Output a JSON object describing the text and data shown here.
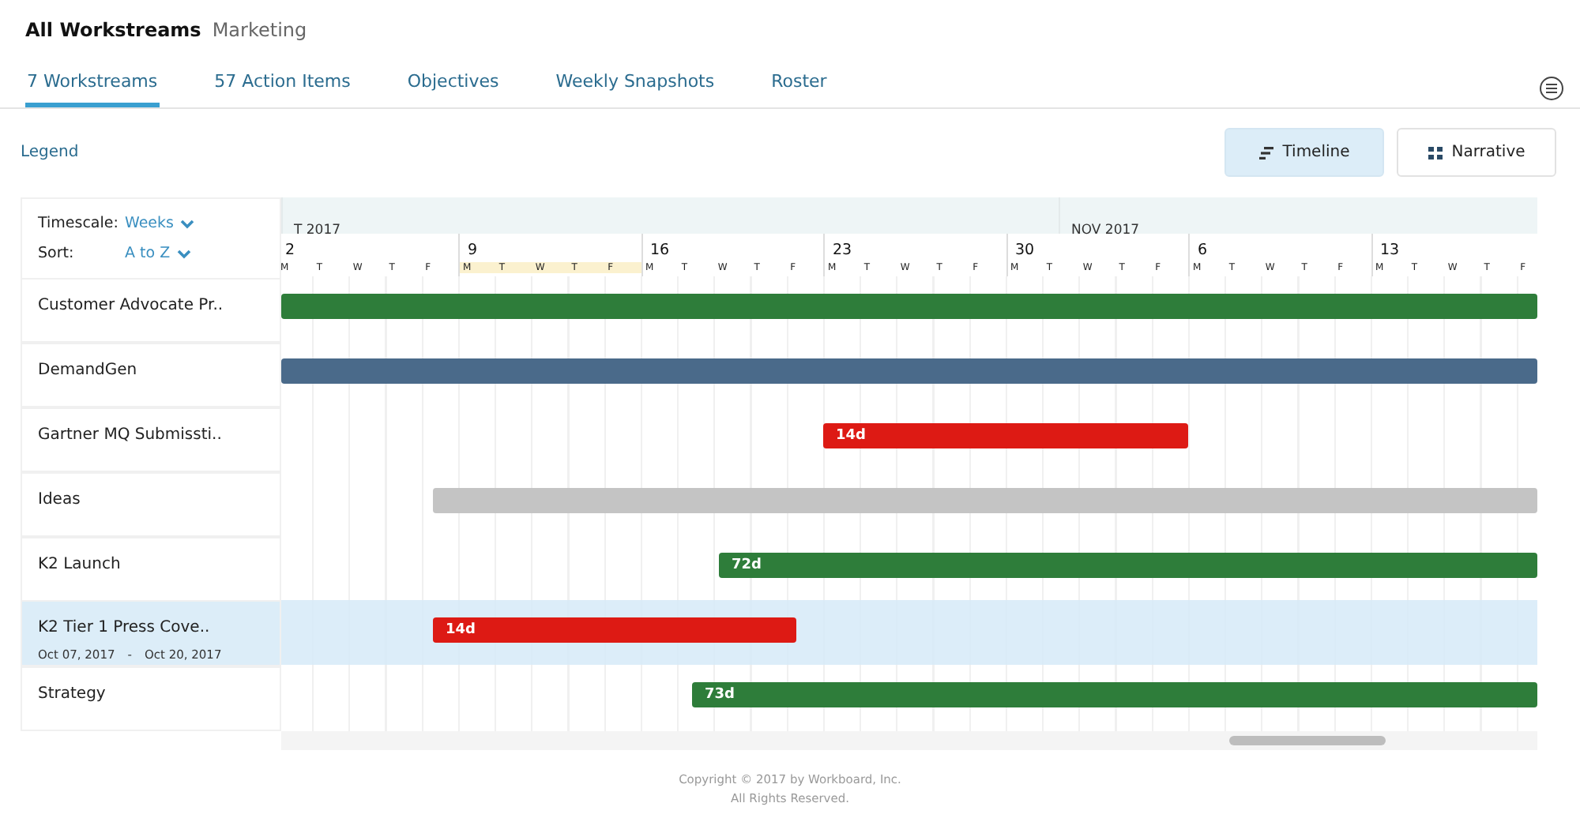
{
  "header": {
    "title": "All Workstreams",
    "subtitle": "Marketing"
  },
  "tabs": [
    {
      "label": "7 Workstreams",
      "selected": true
    },
    {
      "label": "57 Action Items",
      "selected": false
    },
    {
      "label": "Objectives",
      "selected": false
    },
    {
      "label": "Weekly Snapshots",
      "selected": false
    },
    {
      "label": "Roster",
      "selected": false
    }
  ],
  "legend_link": "Legend",
  "view_toggle": [
    {
      "kind": "timeline",
      "label": "Timeline",
      "selected": true
    },
    {
      "kind": "narrative",
      "label": "Narrative",
      "selected": false
    }
  ],
  "controls": {
    "timescale_label": "Timescale:",
    "timescale_value": "Weeks",
    "sort_label": "Sort:",
    "sort_value": "A to Z"
  },
  "timeline": {
    "months": [
      {
        "label": "T 2017"
      },
      {
        "label": "NOV 2017"
      }
    ],
    "weeks": [
      {
        "label": "2",
        "days": [
          "M",
          "T",
          "W",
          "T",
          "F"
        ],
        "selected": false
      },
      {
        "label": "9",
        "days": [
          "M",
          "T",
          "W",
          "T",
          "F"
        ],
        "selected": true
      },
      {
        "label": "16",
        "days": [
          "M",
          "T",
          "W",
          "T",
          "F"
        ],
        "selected": false
      },
      {
        "label": "23",
        "days": [
          "M",
          "T",
          "W",
          "T",
          "F"
        ],
        "selected": false
      },
      {
        "label": "30",
        "days": [
          "M",
          "T",
          "W",
          "T",
          "F"
        ],
        "selected": false
      },
      {
        "label": "6",
        "days": [
          "M",
          "T",
          "W",
          "T",
          "F"
        ],
        "selected": false
      },
      {
        "label": "13",
        "days": [
          "M",
          "T",
          "W",
          "T",
          "F"
        ],
        "selected": false
      }
    ]
  },
  "workstreams": [
    {
      "name": "Customer Advocate Pr..",
      "selected": false,
      "bar": {
        "color": "#2e7d3a"
      }
    },
    {
      "name": "DemandGen",
      "selected": false,
      "bar": {
        "color": "#4a6a8a"
      }
    },
    {
      "name": "Gartner MQ Submissti..",
      "selected": false,
      "bar": {
        "color": "#dd1a14",
        "label": "14d"
      }
    },
    {
      "name": "Ideas",
      "selected": false,
      "bar": {
        "color": "#c4c4c4"
      }
    },
    {
      "name": "K2 Launch",
      "selected": false,
      "bar": {
        "color": "#2e7d3a",
        "label": "72d"
      }
    },
    {
      "name": "K2 Tier 1 Press Cove..",
      "selected": true,
      "dates": [
        "Oct 07, 2017",
        "-",
        "Oct 20, 2017"
      ],
      "bar": {
        "color": "#dd1a14",
        "label": "14d"
      }
    },
    {
      "name": "Strategy",
      "selected": false,
      "bar": {
        "color": "#2e7d3a",
        "label": "73d"
      }
    }
  ],
  "footer": [
    "Copyright © 2017 by Workboard, Inc.",
    "All Rights Reserved."
  ]
}
